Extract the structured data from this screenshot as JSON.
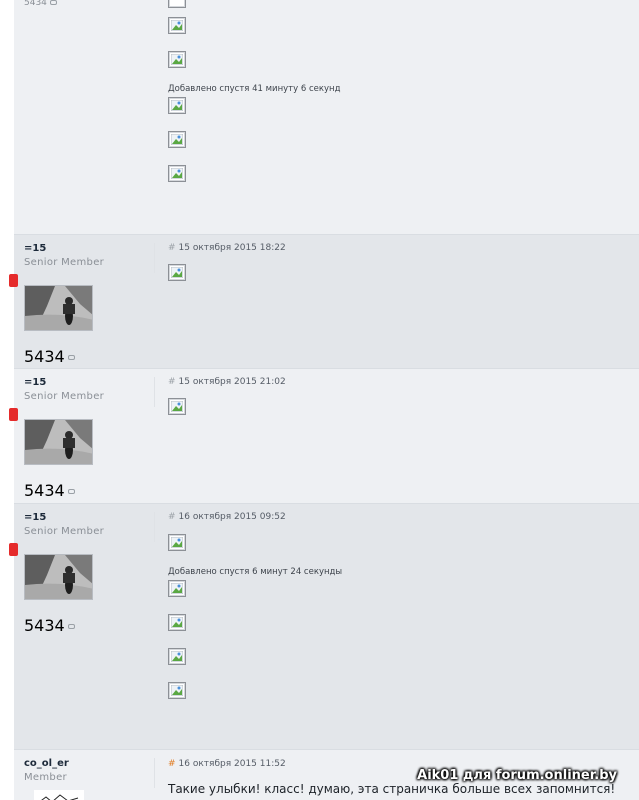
{
  "top_post": {
    "post_count": "5434",
    "added_note": "Добавлено спустя 41 минуту 6 секунд"
  },
  "posts": [
    {
      "nick": "=15",
      "rank": "Senior Member",
      "date": "15 октября 2015 18:22",
      "post_count": "5434"
    },
    {
      "nick": "=15",
      "rank": "Senior Member",
      "date": "15 октября 2015 21:02",
      "post_count": "5434"
    },
    {
      "nick": "=15",
      "rank": "Senior Member",
      "date": "16 октября 2015 09:52",
      "post_count": "5434",
      "added_note": "Добавлено спустя 6 минут 24 секунды"
    }
  ],
  "last_post": {
    "nick": "co_ol_er",
    "rank": "Member",
    "date": "16 октября 2015 11:52",
    "text": "Такие улыбки! класс! думаю, эта страничка больше всех запомнится!"
  },
  "hash_symbol": "#",
  "watermark": "Aik01 для forum.onliner.by",
  "colors": {
    "online_marker": "#e52b2b",
    "post_bg_light": "#eef0f3",
    "post_bg_dark": "#e3e6ea",
    "hash_highlight": "#e07a1f"
  }
}
